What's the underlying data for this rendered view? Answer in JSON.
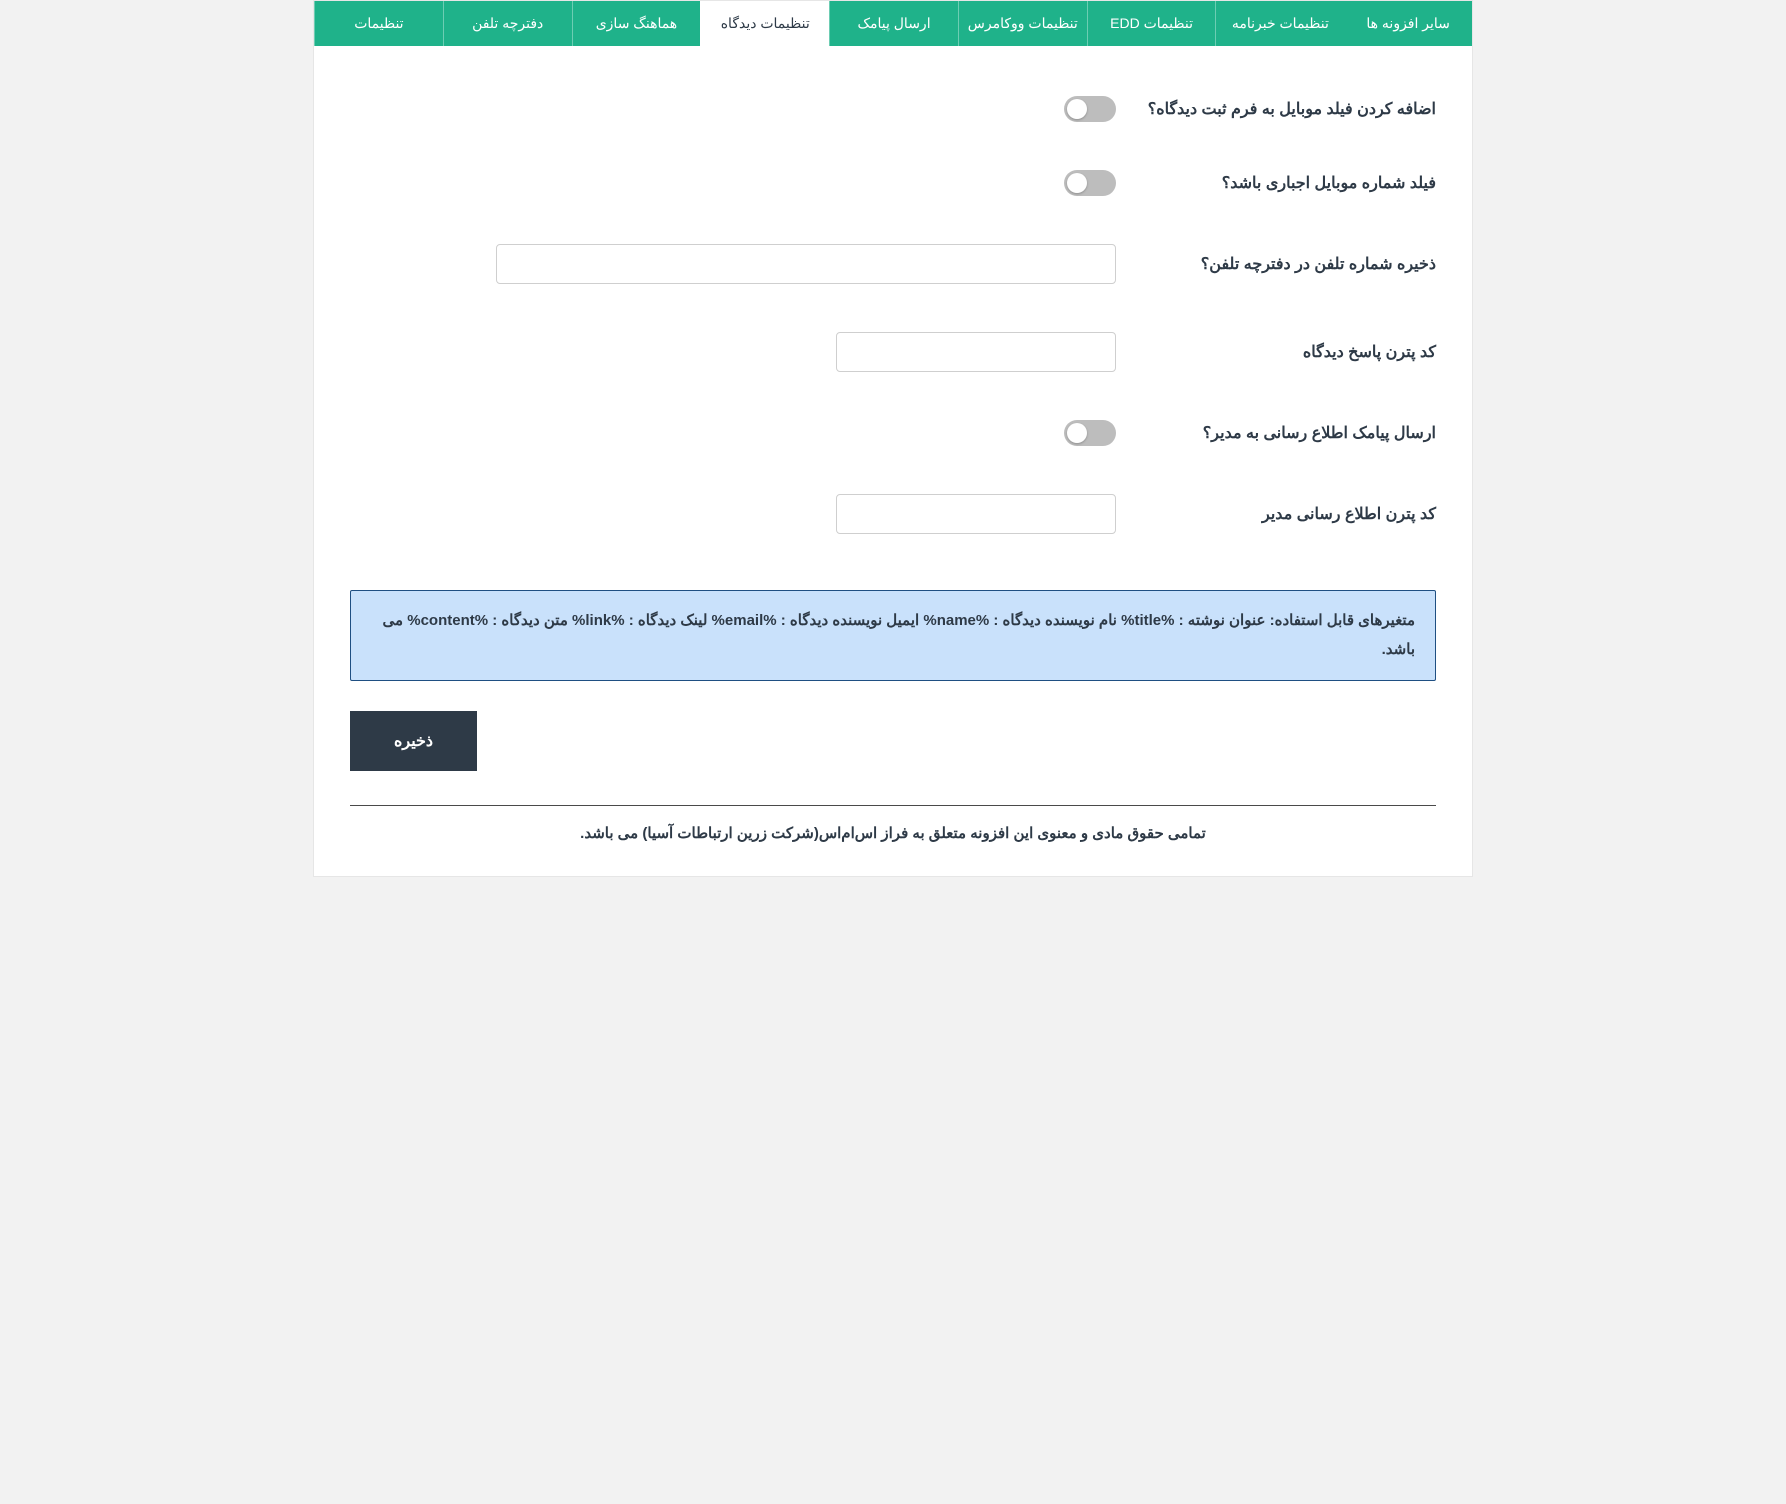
{
  "tabs": [
    {
      "label": "تنظیمات",
      "active": false
    },
    {
      "label": "دفترچه تلفن",
      "active": false
    },
    {
      "label": "هماهنگ سازی",
      "active": false
    },
    {
      "label": "تنظیمات دیدگاه",
      "active": true
    },
    {
      "label": "ارسال پیامک",
      "active": false
    },
    {
      "label": "تنظیمات ووکامرس",
      "active": false
    },
    {
      "label": "تنظیمات EDD",
      "active": false
    },
    {
      "label": "تنظیمات خبرنامه",
      "active": false
    },
    {
      "label": "سایر افزونه ها",
      "active": false
    }
  ],
  "fields": {
    "add_mobile_field": {
      "label": "اضافه کردن فیلد موبایل به فرم ثبت دیدگاه؟",
      "value": false
    },
    "mobile_required": {
      "label": "فیلد شماره موبایل اجباری باشد؟",
      "value": false
    },
    "save_phonebook": {
      "label": "ذخیره شماره تلفن در دفترچه تلفن؟",
      "value": ""
    },
    "reply_pattern": {
      "label": "کد پترن پاسخ دیدگاه",
      "value": ""
    },
    "notify_admin": {
      "label": "ارسال پیامک اطلاع رسانی به مدیر؟",
      "value": false
    },
    "admin_pattern": {
      "label": "کد پترن اطلاع رسانی مدیر",
      "value": ""
    }
  },
  "info_text": "متغیرهای قابل استفاده: عنوان نوشته : %title% نام نویسنده دیدگاه : %name% ایمیل نویسنده دیدگاه : %email% لینک دیدگاه : %link% متن دیدگاه : %content% می باشد.",
  "save_label": "ذخیره",
  "footer_text": "تمامی حقوق مادی و معنوی این افزونه متعلق به فراز اس‌ام‌اس(شرکت زرین ارتباطات آسیا) می باشد."
}
